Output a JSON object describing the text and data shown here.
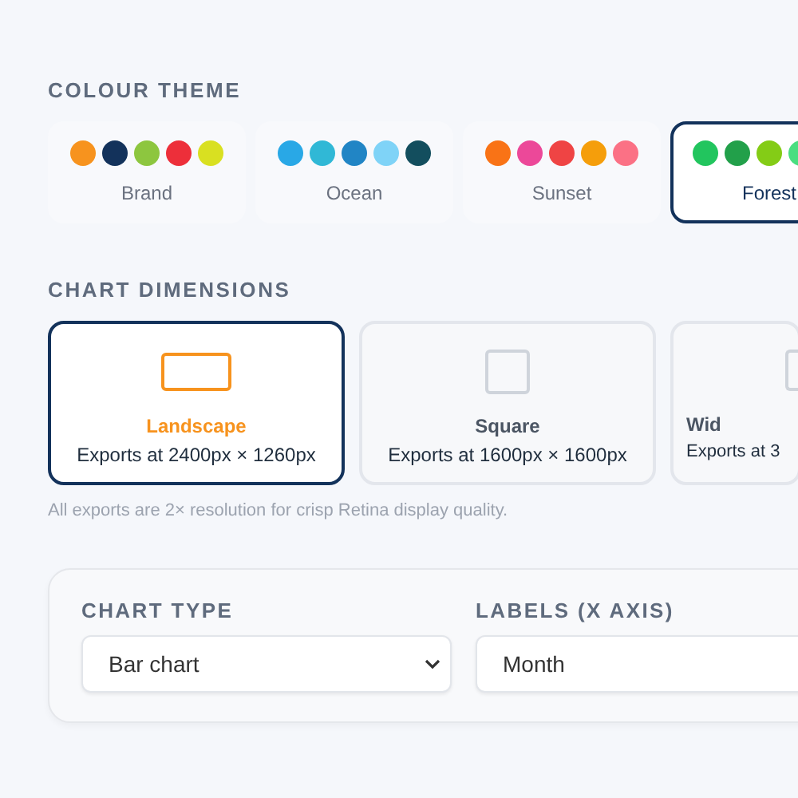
{
  "colour_theme": {
    "heading": "COLOUR THEME",
    "themes": [
      {
        "name": "Brand",
        "selected": false,
        "swatches": [
          {
            "color": "#f7931e"
          },
          {
            "color": "#13325b"
          },
          {
            "color": "#8dc63f"
          },
          {
            "color": "#ed2f3a"
          },
          {
            "color": "#d9e021"
          }
        ]
      },
      {
        "name": "Ocean",
        "selected": false,
        "swatches": [
          {
            "color": "#29a8e6"
          },
          {
            "color": "#30b8d6"
          },
          {
            "color": "#2185c5"
          },
          {
            "color": "#7fd3f7"
          },
          {
            "color": "#134e5e"
          }
        ]
      },
      {
        "name": "Sunset",
        "selected": false,
        "swatches": [
          {
            "color": "#f97316"
          },
          {
            "color": "#ec4899"
          },
          {
            "color": "#ef4444"
          },
          {
            "color": "#f59e0b"
          },
          {
            "color": "#fb7185"
          }
        ]
      },
      {
        "name": "Forest",
        "selected": true,
        "swatches": [
          {
            "color": "#22c55e"
          },
          {
            "color": "#22a04a"
          },
          {
            "color": "#84cc16"
          },
          {
            "color": "#4ade80"
          }
        ]
      }
    ]
  },
  "chart_dimensions": {
    "heading": "CHART DIMENSIONS",
    "options": [
      {
        "kind": "landscape",
        "name": "Landscape",
        "detail": "Exports at 2400px × 1260px",
        "selected": true
      },
      {
        "kind": "square",
        "name": "Square",
        "detail": "Exports at 1600px × 1600px",
        "selected": false
      },
      {
        "kind": "wide",
        "name": "Wid",
        "detail": "Exports at 3",
        "selected": false
      }
    ],
    "note": "All exports are 2× resolution for crisp Retina display quality."
  },
  "settings": {
    "chart_type": {
      "label": "CHART TYPE",
      "value": "Bar chart"
    },
    "labels": {
      "label": "LABELS (X AXIS)",
      "value": "Month"
    }
  }
}
